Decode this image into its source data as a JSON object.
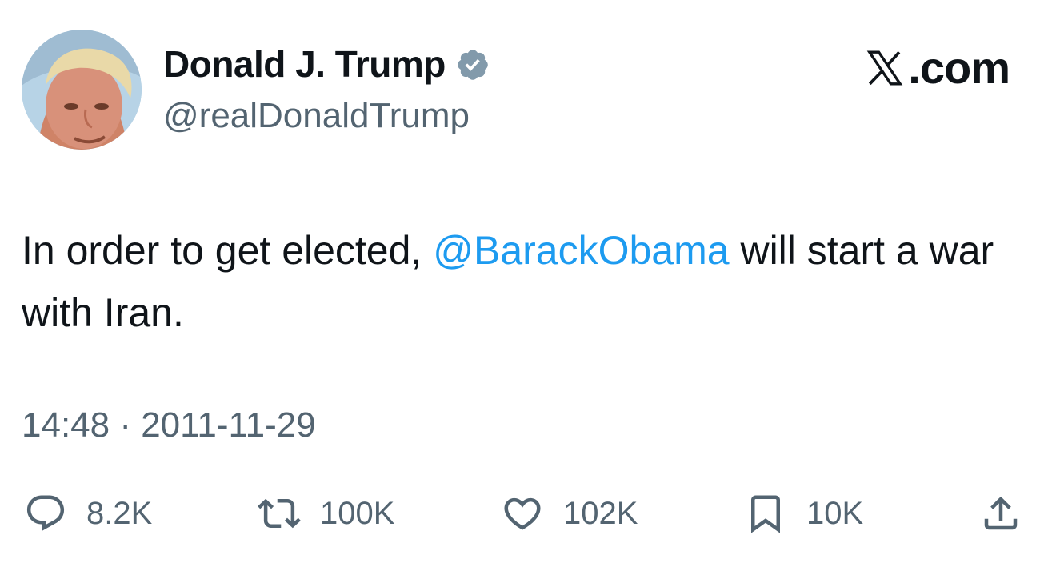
{
  "author": {
    "display_name": "Donald J. Trump",
    "handle": "@realDonaldTrump",
    "verified": true
  },
  "brand": {
    "text": ".com",
    "logo": "x-logo"
  },
  "tweet": {
    "text_before": "In order to get elected, ",
    "mention": "@BarackObama",
    "text_after": " will start a war with Iran.",
    "timestamp": "14:48 · 2011-11-29"
  },
  "actions": {
    "reply": {
      "icon": "reply-icon",
      "count": "8.2K"
    },
    "retweet": {
      "icon": "retweet-icon",
      "count": "100K"
    },
    "like": {
      "icon": "heart-icon",
      "count": "102K"
    },
    "bookmark": {
      "icon": "bookmark-icon",
      "count": "10K"
    },
    "share": {
      "icon": "share-icon"
    }
  },
  "colors": {
    "text": "#0f1419",
    "secondary": "#536471",
    "accent": "#1d9bf0"
  }
}
